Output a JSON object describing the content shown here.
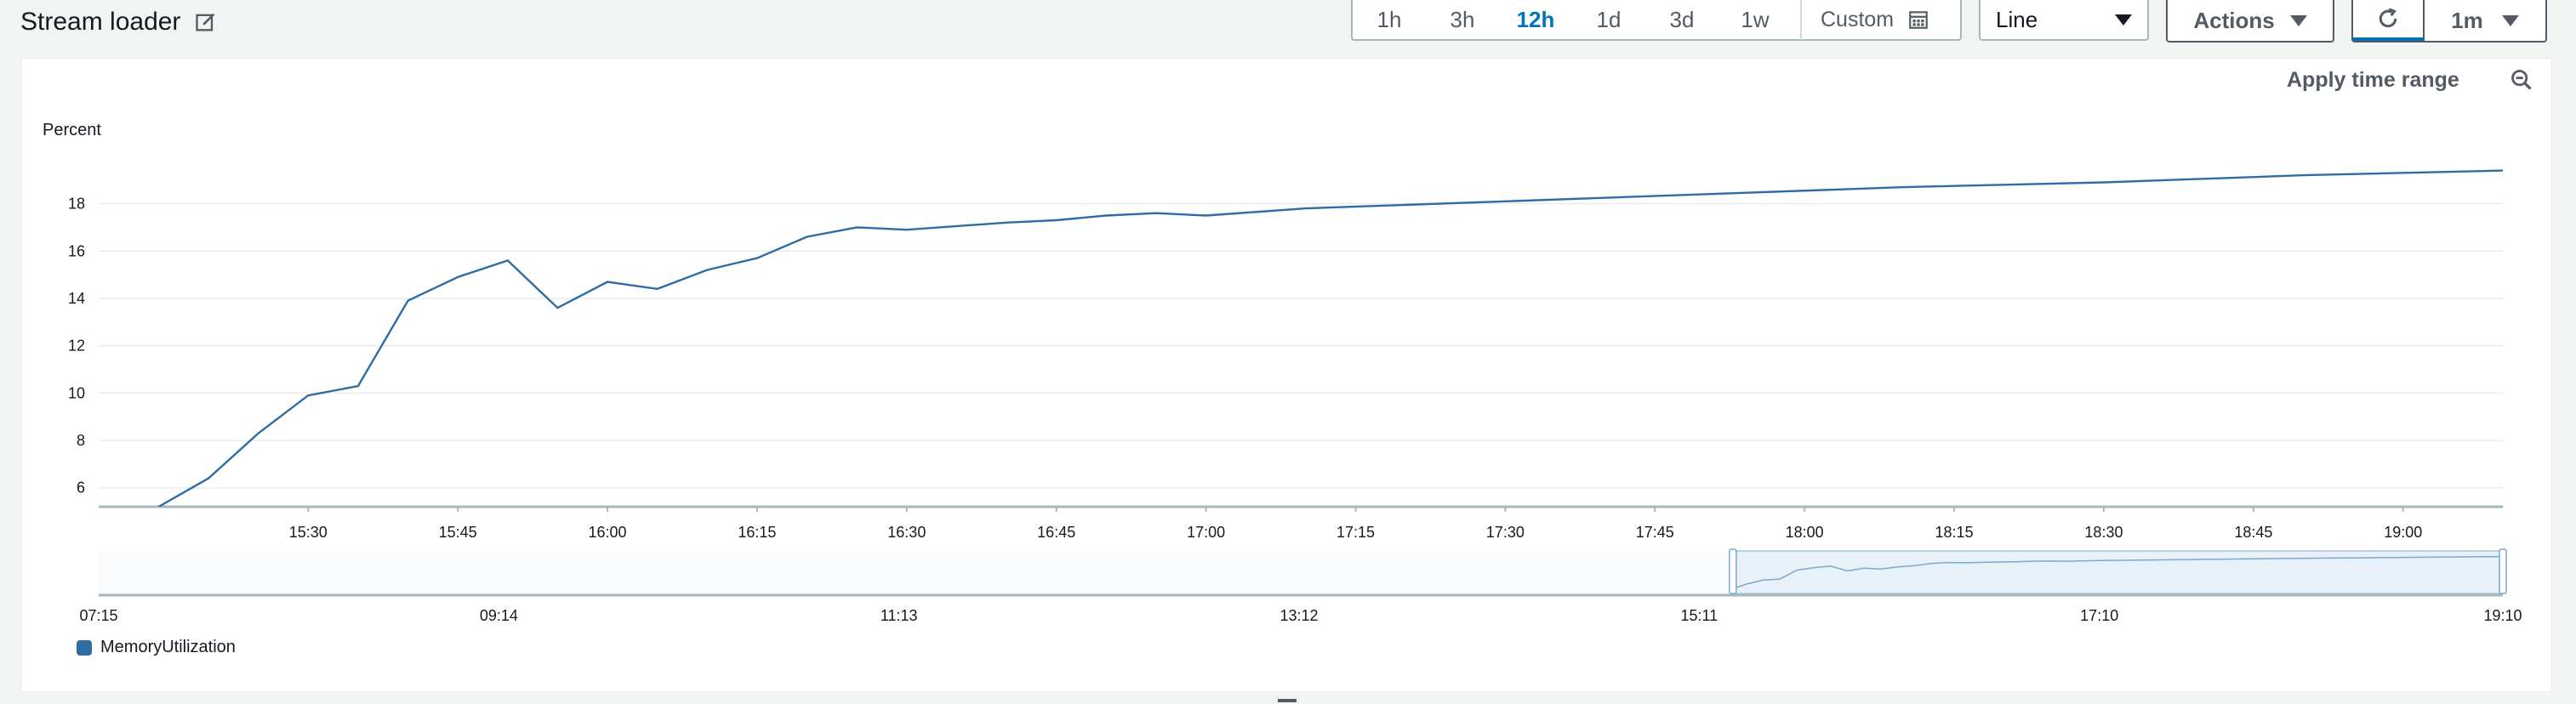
{
  "header": {
    "title": "Stream loader",
    "time_ranges": [
      "1h",
      "3h",
      "12h",
      "1d",
      "3d",
      "1w"
    ],
    "active_range": "12h",
    "custom_label": "Custom",
    "chart_type_value": "Line",
    "actions_label": "Actions",
    "refresh_interval": "1m"
  },
  "panel": {
    "apply_time_range_label": "Apply time range",
    "y_unit_label": "Percent"
  },
  "colors": {
    "series": "#2e6da4",
    "accent": "#0073bb",
    "grid": "#e9ebed"
  },
  "chart_data": [
    {
      "type": "line",
      "title": "",
      "ylabel": "Percent",
      "xlabel": "",
      "ylim": [
        5.2,
        19.6
      ],
      "y_ticks": [
        6,
        8,
        10,
        12,
        14,
        16,
        18
      ],
      "x_ticks": [
        "15:30",
        "15:45",
        "16:00",
        "16:15",
        "16:30",
        "16:45",
        "17:00",
        "17:15",
        "17:30",
        "17:45",
        "18:00",
        "18:15",
        "18:30",
        "18:45",
        "19:00"
      ],
      "x_tick_minutes": [
        930,
        945,
        960,
        975,
        990,
        1005,
        1020,
        1035,
        1050,
        1065,
        1080,
        1095,
        1110,
        1125,
        1140
      ],
      "xlim_minutes": [
        909,
        1150
      ],
      "grid": true,
      "legend": "bottom-left",
      "series": [
        {
          "name": "MemoryUtilization",
          "x_minutes": [
            915,
            920,
            925,
            930,
            935,
            940,
            945,
            950,
            955,
            960,
            965,
            970,
            975,
            980,
            985,
            990,
            1000,
            1005,
            1010,
            1015,
            1020,
            1030,
            1050,
            1070,
            1090,
            1110,
            1130,
            1150
          ],
          "values": [
            5.2,
            6.4,
            8.3,
            9.9,
            10.3,
            13.9,
            14.9,
            15.6,
            13.6,
            14.7,
            14.4,
            15.2,
            15.7,
            16.6,
            17.0,
            16.9,
            17.2,
            17.3,
            17.5,
            17.6,
            17.5,
            17.8,
            18.1,
            18.4,
            18.7,
            18.9,
            19.2,
            19.4
          ]
        }
      ]
    },
    {
      "type": "line",
      "title": "",
      "x_ticks": [
        "07:15",
        "09:14",
        "11:13",
        "13:12",
        "15:11",
        "17:10",
        "19:10"
      ],
      "selected_range": [
        "15:21",
        "19:10"
      ]
    }
  ],
  "legend": {
    "items": [
      {
        "label": "MemoryUtilization",
        "color": "#2e6da4"
      }
    ]
  }
}
